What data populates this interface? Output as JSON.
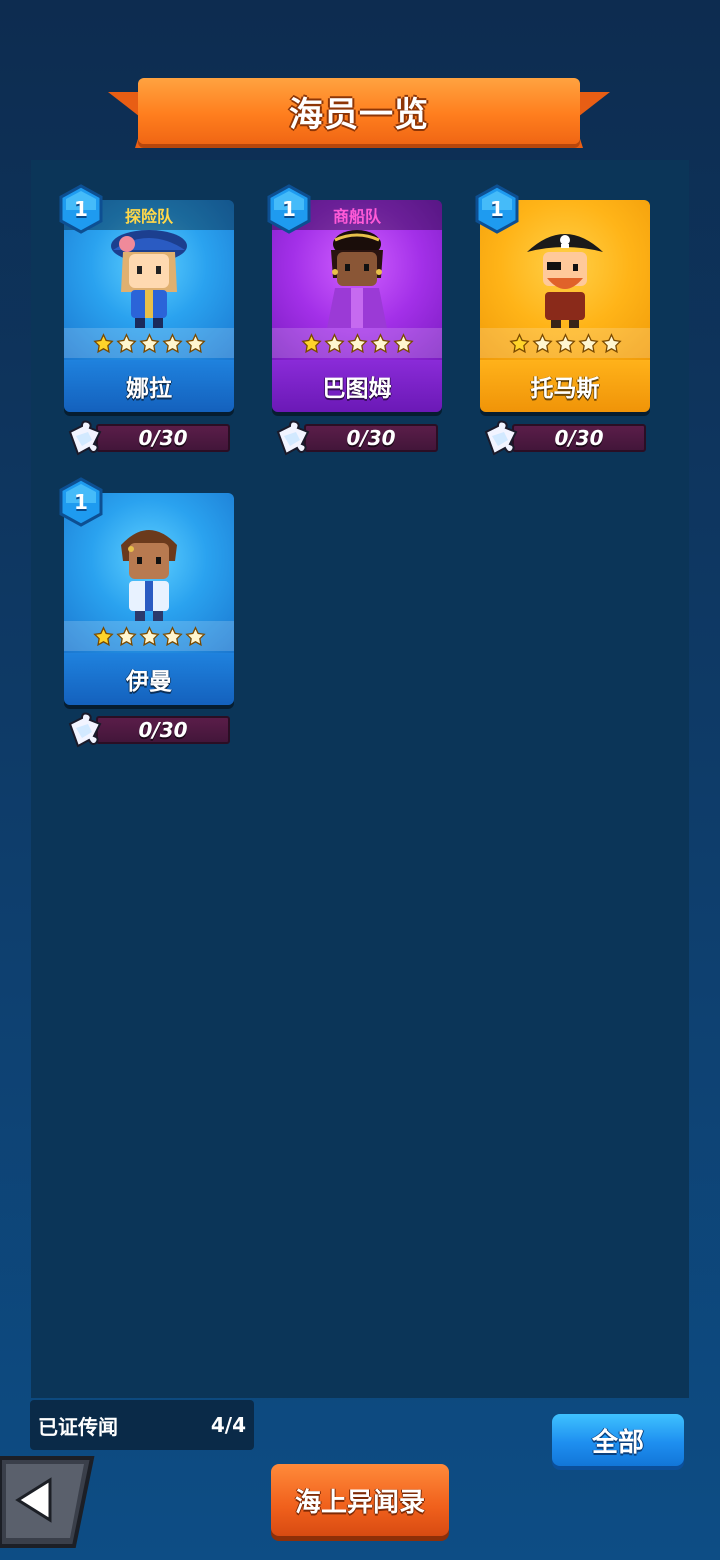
{
  "header": {
    "title": "海员一览"
  },
  "crew": [
    {
      "name": "娜拉",
      "team": "探险队",
      "team_color": "#ffd84a",
      "level": "1",
      "stars_filled": 1,
      "stars_total": 5,
      "shards": "0/30",
      "theme": "blue"
    },
    {
      "name": "巴图姆",
      "team": "商船队",
      "team_color": "#ff5ad8",
      "level": "1",
      "stars_filled": 1,
      "stars_total": 5,
      "shards": "0/30",
      "theme": "purple"
    },
    {
      "name": "托马斯",
      "team": "",
      "level": "1",
      "stars_filled": 1,
      "stars_total": 5,
      "shards": "0/30",
      "theme": "gold"
    },
    {
      "name": "伊曼",
      "team": "",
      "level": "1",
      "stars_filled": 1,
      "stars_total": 5,
      "shards": "0/30",
      "theme": "blue"
    }
  ],
  "footer": {
    "stat_label": "已证传闻",
    "stat_value": "4/4",
    "filter_button": "全部",
    "log_button": "海上异闻录"
  },
  "icons": {
    "back": "back-arrow-icon",
    "shard": "puzzle-piece-icon",
    "level": "hexagon-level-badge",
    "star": "star-icon"
  },
  "colors": {
    "accent_orange": "#ff7e1e",
    "accent_blue": "#1e8ff0",
    "panel": "#0b3558"
  }
}
